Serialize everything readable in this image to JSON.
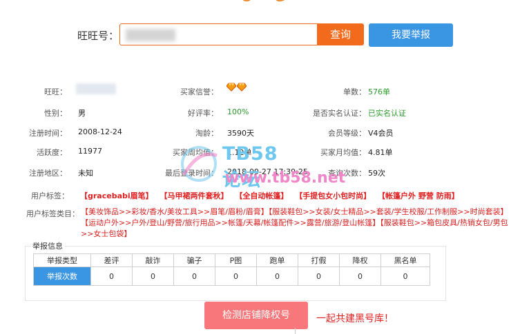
{
  "search": {
    "label": "旺旺号：",
    "placeholder": "",
    "query_button": "查询",
    "report_button": "我要举报"
  },
  "profile": {
    "labels": {
      "wangwang": "旺旺：",
      "buyer_credit": "买家信誉：",
      "order_count": "单数：",
      "gender": "性别：",
      "positive_rate": "好评率：",
      "realname": "是否实名认证：",
      "register_time": "注册时间：",
      "taobao_age": "淘龄：",
      "member_level": "会员等级：",
      "activity": "活跃度：",
      "buyer_weekly": "买家周均值：",
      "buyer_monthly": "买家月均值：",
      "register_area": "注册地区：",
      "last_login": "最后登录时间：",
      "query_count": "查询次数："
    },
    "values": {
      "order_count": "576单",
      "gender": "男",
      "positive_rate": "100%",
      "realname": "已实名认证",
      "register_time": "2008-12-24",
      "taobao_age": "3590天",
      "member_level": "V4会员",
      "activity": "11977",
      "buyer_weekly": "1.12单",
      "buyer_monthly": "4.81单",
      "register_area": "未知",
      "last_login": "2018-09-27 17:39:25",
      "query_count": "59次"
    },
    "credit_icons": [
      "diamond-icon",
      "diamond-icon"
    ]
  },
  "tags": {
    "label": "用户标签：",
    "items": [
      "【gracebabi眉笔】",
      "【马甲裙两件套秋】",
      "【全自动帐篷】",
      "【手提包女小包时尚】",
      "【帐篷户外 野营 防雨】"
    ]
  },
  "categories": {
    "label": "用户标签类目：",
    "text": "【美妆饰品>>彩妆/香水/美妆工具>>眉笔/眉粉/眉膏】【服装鞋包>>女装/女士精品>>套装/学生校服/工作制服>>时尚套装】【运动户外>>户外/登山/野营/旅行用品>>帐篷/天幕/帐篷配件>>露营/旅游/登山帐篷】【服装鞋包>>箱包皮具/热销女包/男包>>女士包袋】"
  },
  "watermark": {
    "text": "TB58论坛",
    "url": "www.tb58.net"
  },
  "report": {
    "title": "举报信息",
    "headers": [
      "举报类型",
      "差评",
      "敲诈",
      "骗子",
      "P图",
      "跑单",
      "打假",
      "降权",
      "黑名单"
    ],
    "row_label": "举报次数",
    "row_values": [
      "0",
      "0",
      "0",
      "0",
      "0",
      "0",
      "0",
      "0"
    ]
  },
  "actions": {
    "detect_button": "检测店铺降权号",
    "slogan": "一起共建黑号库！"
  },
  "colors": {
    "orange": "#f26b1d",
    "blue": "#3a95e3",
    "red": "#e02020",
    "green": "#2b9b2b",
    "pink_button": "#f7777a"
  }
}
